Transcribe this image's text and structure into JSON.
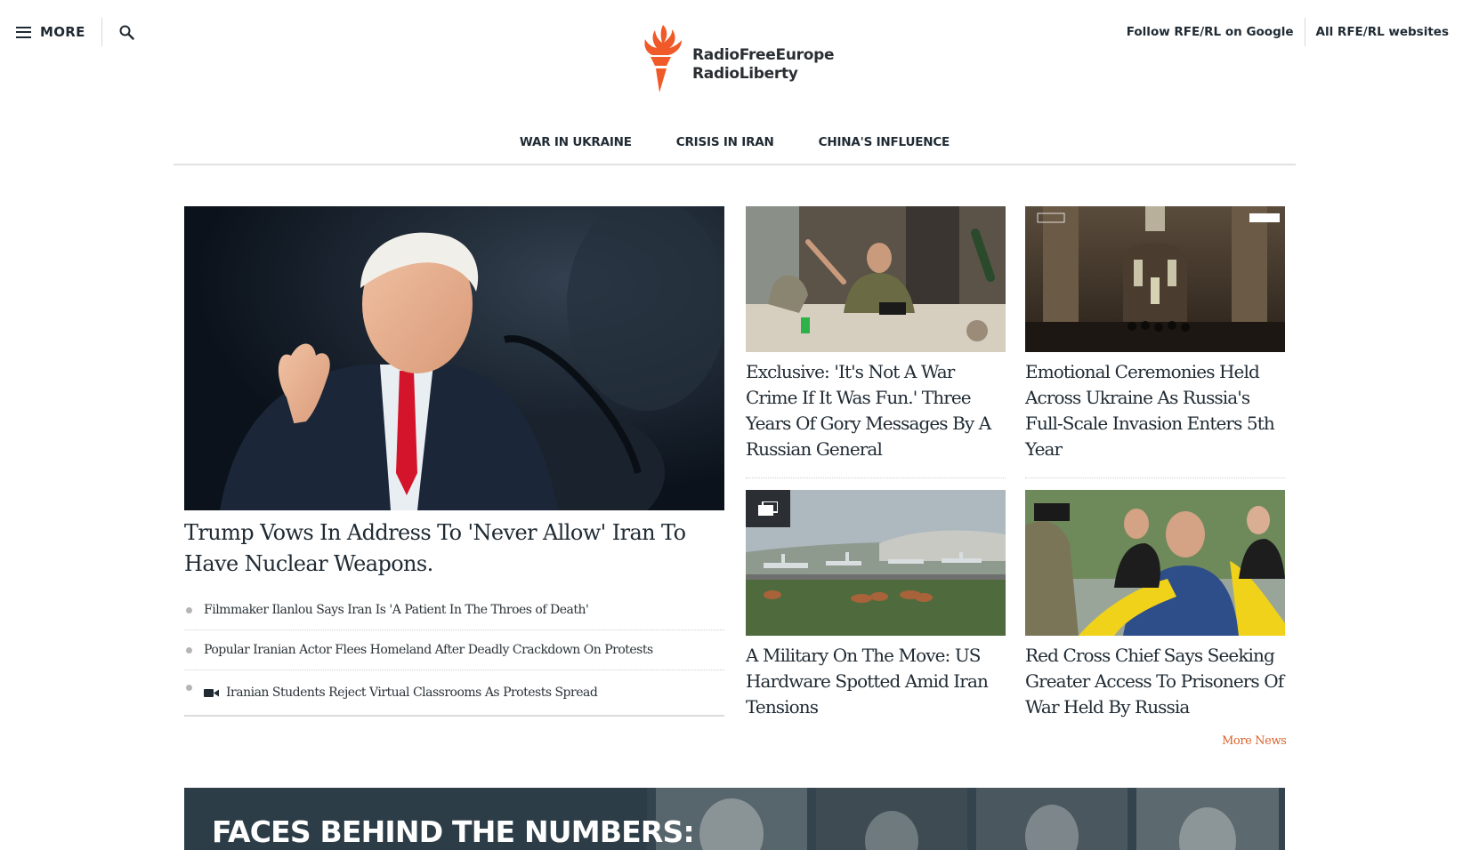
{
  "header": {
    "menu_label": "MORE",
    "logo_line1": "RadioFreeEurope",
    "logo_line2": "RadioLiberty",
    "follow_link": "Follow RFE/RL on Google",
    "all_sites_link": "All RFE/RL websites"
  },
  "nav": {
    "items": [
      "WAR IN UKRAINE",
      "CRISIS IN IRAN",
      "CHINA'S INFLUENCE"
    ]
  },
  "lead": {
    "title": "Trump Vows In Address To 'Never Allow' Iran To Have Nuclear Weapons.",
    "related": [
      "Filmmaker Ilanlou Says Iran Is 'A Patient In The Throes of Death'",
      "Popular Iranian Actor Flees Homeland After Deadly Crackdown On Protests",
      "Iranian Students Reject Virtual Classrooms As Protests Spread"
    ]
  },
  "cards": [
    {
      "title": "Exclusive: 'It's Not A War Crime If It Was Fun.' Three Years Of Gory Messages By A Russian General"
    },
    {
      "title": "Emotional Ceremonies Held Across Ukraine As Russia's Full-Scale Invasion Enters 5th Year"
    },
    {
      "title": "A Military On The Move: US Hardware Spotted Amid Iran Tensions"
    },
    {
      "title": "Red Cross Chief Says Seeking Greater Access To Prisoners Of War Held By Russia"
    }
  ],
  "more_news": "More News",
  "banner": {
    "title": "FACES BEHIND THE NUMBERS:"
  },
  "colors": {
    "brand_orange": "#f05a28",
    "link_orange": "#d9622b",
    "text": "#1f2a33"
  }
}
